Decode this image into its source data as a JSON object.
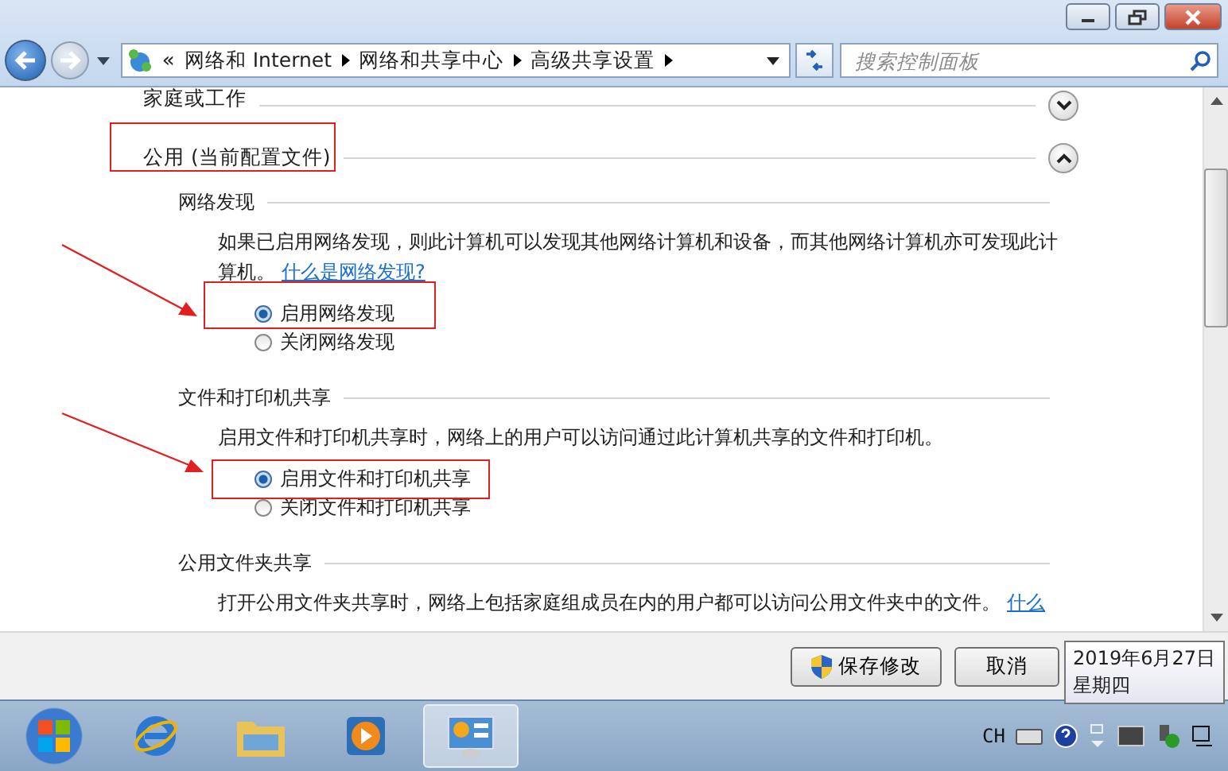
{
  "address_bar": {
    "overflow": "«",
    "crumbs": [
      "网络和 Internet",
      "网络和共享中心",
      "高级共享设置"
    ]
  },
  "search": {
    "placeholder": "搜索控制面板"
  },
  "sections": [
    {
      "title": "家庭或工作",
      "expanded": false
    },
    {
      "title": "公用 (当前配置文件)",
      "expanded": true,
      "groups": [
        {
          "heading": "网络发现",
          "description": "如果已启用网络发现，则此计算机可以发现其他网络计算机和设备，而其他网络计算机亦可发现此计算机。",
          "link": "什么是网络发现?",
          "options": [
            {
              "label": "启用网络发现",
              "selected": true
            },
            {
              "label": "关闭网络发现",
              "selected": false
            }
          ]
        },
        {
          "heading": "文件和打印机共享",
          "description": "启用文件和打印机共享时，网络上的用户可以访问通过此计算机共享的文件和打印机。",
          "options": [
            {
              "label": "启用文件和打印机共享",
              "selected": true
            },
            {
              "label": "关闭文件和打印机共享",
              "selected": false
            }
          ]
        },
        {
          "heading": "公用文件夹共享",
          "description": "打开公用文件夹共享时，网络上包括家庭组成员在内的用户都可以访问公用文件夹中的文件。",
          "link": "什么"
        }
      ]
    }
  ],
  "buttons": [
    {
      "label": "保存修改",
      "kind": "admin"
    },
    {
      "label": "取消",
      "kind": "plain"
    }
  ],
  "tooltip": {
    "lines": [
      "2019年6月27日",
      "星期四"
    ]
  },
  "taskbar": {
    "apps": [
      {
        "kind": "ie",
        "selected": false
      },
      {
        "kind": "folder",
        "selected": false
      },
      {
        "kind": "media",
        "selected": false
      },
      {
        "kind": "control-panel",
        "selected": true
      }
    ],
    "language": "CH"
  }
}
